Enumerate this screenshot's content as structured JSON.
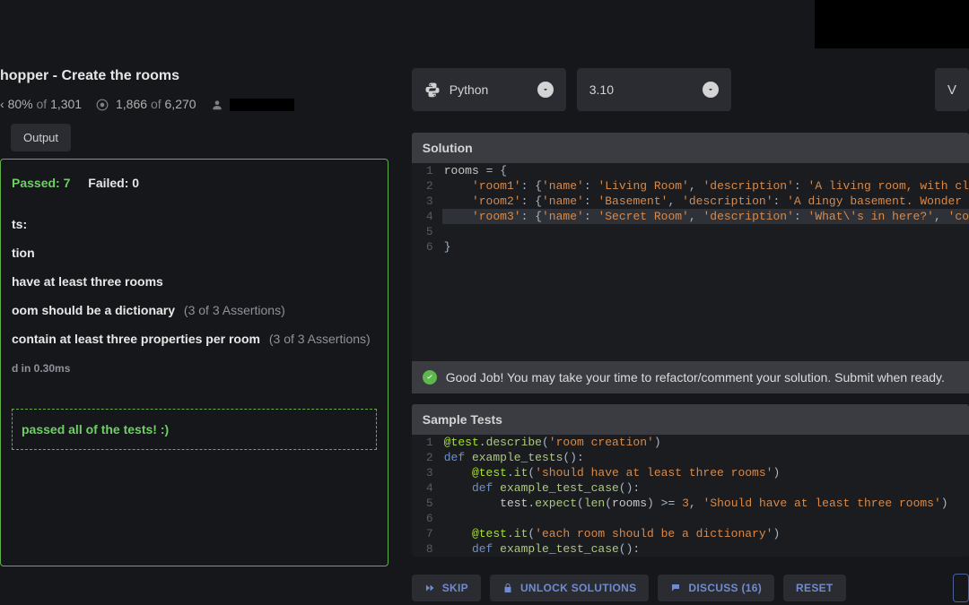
{
  "kata": {
    "title": "hopper - Create the rooms",
    "stats": {
      "percent": "80%",
      "of1": "of",
      "total1": "1,301",
      "count2": "1,866",
      "of2": "of",
      "total2": "6,270"
    }
  },
  "output_label": "Output",
  "results": {
    "passed_label": "Passed: 7",
    "failed_label": "Failed: 0",
    "ts_label": "ts:",
    "tion_label": "tion",
    "line1": "have at least three rooms",
    "line2": "oom should be a dictionary",
    "assert2": "(3 of 3 Assertions)",
    "line3": "contain at least three properties per room",
    "assert3": "(3 of 3 Assertions)",
    "timing": "d in 0.30ms",
    "all_passed": "passed all of the tests! :)"
  },
  "dropdowns": {
    "language": "Python",
    "version": "3.10",
    "v_btn": "V"
  },
  "solution": {
    "header": "Solution",
    "lines": [
      "rooms = {",
      "    'room1': {'name': 'Living Room', 'description': 'A living room, with cl",
      "    'room2': {'name': 'Basement', 'description': 'A dingy basement. Wonder",
      "    'room3': {'name': 'Secret Room', 'description': 'What\\'s in here?', 'co",
      "",
      "}"
    ]
  },
  "goodjob": "Good Job! You may take your time to refactor/comment your solution. Submit when ready.",
  "sampletests": {
    "header": "Sample Tests"
  },
  "actions": {
    "skip": "SKIP",
    "unlock": "UNLOCK SOLUTIONS",
    "discuss": "DISCUSS (16)",
    "reset": "RESET"
  }
}
